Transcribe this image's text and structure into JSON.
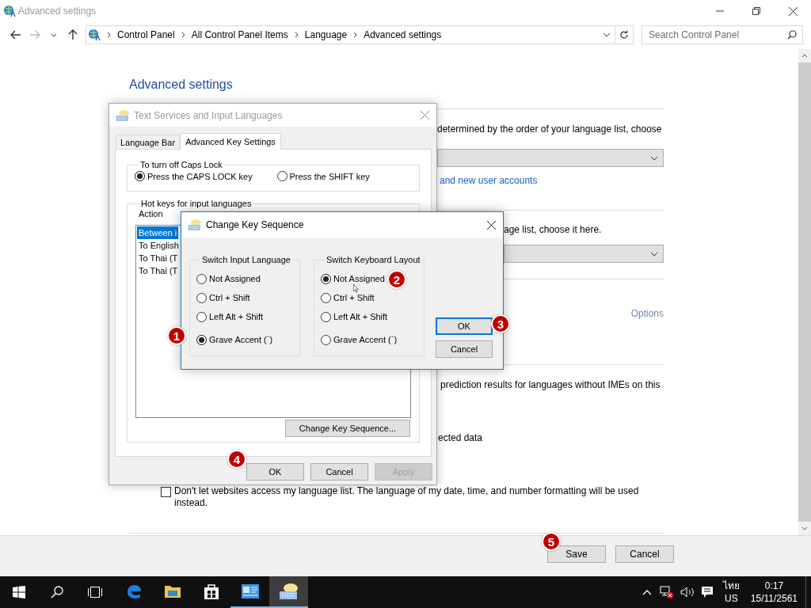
{
  "window": {
    "title": "Advanced settings"
  },
  "address_bar": {
    "crumbs": [
      "Control Panel",
      "All Control Panel Items",
      "Language",
      "Advanced settings"
    ]
  },
  "search": {
    "placeholder": "Search Control Panel"
  },
  "page": {
    "heading": "Advanced settings",
    "override_text": "determined by the order of your language list, choose",
    "accounts_link": "and new user accounts",
    "override_text_2": "age list, choose it here.",
    "options_link": "Options",
    "prediction_text": "prediction results for languages without IMEs on this",
    "data_text": "ected data",
    "websites_checkbox": {
      "label": "Don't let websites access my language list. The language of my date, time, and number formatting will be used instead.",
      "checked": false
    }
  },
  "footer_buttons": [
    "Save",
    "Cancel"
  ],
  "dialog": {
    "title": "Text Services and Input Languages",
    "tabs": [
      {
        "label": "Language Bar",
        "selected": false
      },
      {
        "label": "Advanced Key Settings",
        "selected": true
      }
    ],
    "caps_group": {
      "title": "To turn off Caps Lock",
      "options": [
        {
          "label": "Press the CAPS LOCK key",
          "selected": true
        },
        {
          "label": "Press the SHIFT key",
          "selected": false
        }
      ]
    },
    "hotkeys_group": {
      "title": "Hot keys for input languages",
      "column": "Action",
      "items": [
        {
          "label": "Between i",
          "selected": true
        },
        {
          "label": "To English",
          "selected": false
        },
        {
          "label": "To Thai (T",
          "selected": false
        },
        {
          "label": "To Thai (T",
          "selected": false
        }
      ],
      "button": "Change Key Sequence..."
    },
    "buttons": [
      {
        "label": "OK",
        "disabled": false
      },
      {
        "label": "Cancel",
        "disabled": false
      },
      {
        "label": "Apply",
        "disabled": true
      }
    ]
  },
  "key_dialog": {
    "title": "Change Key Sequence",
    "groups": [
      {
        "title": "Switch Input Language",
        "options": [
          {
            "label": "Not Assigned",
            "selected": false
          },
          {
            "label": "Ctrl + Shift",
            "selected": false
          },
          {
            "label": "Left Alt + Shift",
            "selected": false
          },
          {
            "label": "Grave Accent (`)",
            "selected": true
          }
        ]
      },
      {
        "title": "Switch Keyboard Layout",
        "options": [
          {
            "label": "Not Assigned",
            "selected": true
          },
          {
            "label": "Ctrl + Shift",
            "selected": false
          },
          {
            "label": "Left Alt + Shift",
            "selected": false
          },
          {
            "label": "Grave Accent (`)",
            "selected": false
          }
        ]
      }
    ],
    "buttons": [
      {
        "label": "OK",
        "focused": true
      },
      {
        "label": "Cancel",
        "focused": false
      }
    ]
  },
  "annotations": [
    "1",
    "2",
    "3",
    "4",
    "5"
  ],
  "taskbar": {
    "apps": [
      {
        "kind": "edge",
        "running": false,
        "active": false
      },
      {
        "kind": "explorer",
        "running": false,
        "active": false
      },
      {
        "kind": "store",
        "running": false,
        "active": false
      },
      {
        "kind": "panel",
        "running": true,
        "active": false
      },
      {
        "kind": "keyboard",
        "running": true,
        "active": true
      }
    ]
  },
  "tray": {
    "language": "ไทย",
    "layout": "US",
    "time": "0:17",
    "date": "15/11/2561"
  }
}
